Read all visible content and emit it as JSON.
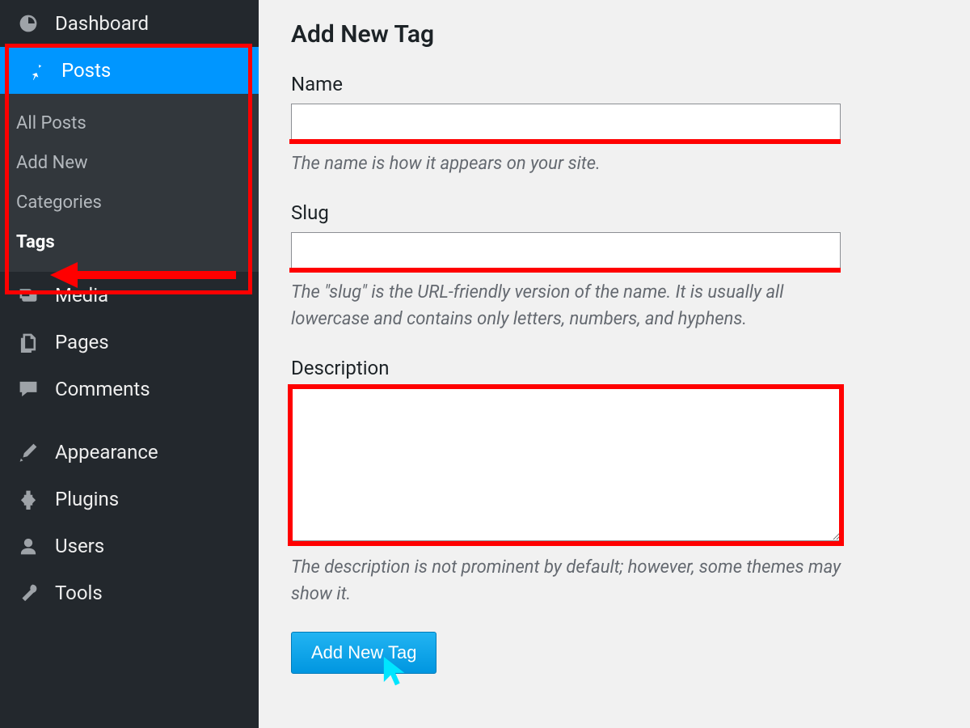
{
  "sidebar": {
    "dashboard": "Dashboard",
    "posts": "Posts",
    "submenu": {
      "all_posts": "All Posts",
      "add_new": "Add New",
      "categories": "Categories",
      "tags": "Tags"
    },
    "media": "Media",
    "pages": "Pages",
    "comments": "Comments",
    "appearance": "Appearance",
    "plugins": "Plugins",
    "users": "Users",
    "tools": "Tools"
  },
  "main": {
    "title": "Add New Tag",
    "name": {
      "label": "Name",
      "value": "",
      "help": "The name is how it appears on your site."
    },
    "slug": {
      "label": "Slug",
      "value": "",
      "help": "The \"slug\" is the URL-friendly version of the name. It is usually all lowercase and contains only letters, numbers, and hyphens."
    },
    "description": {
      "label": "Description",
      "value": "",
      "help": "The description is not prominent by default; however, some themes may show it."
    },
    "submit_label": "Add New Tag"
  }
}
